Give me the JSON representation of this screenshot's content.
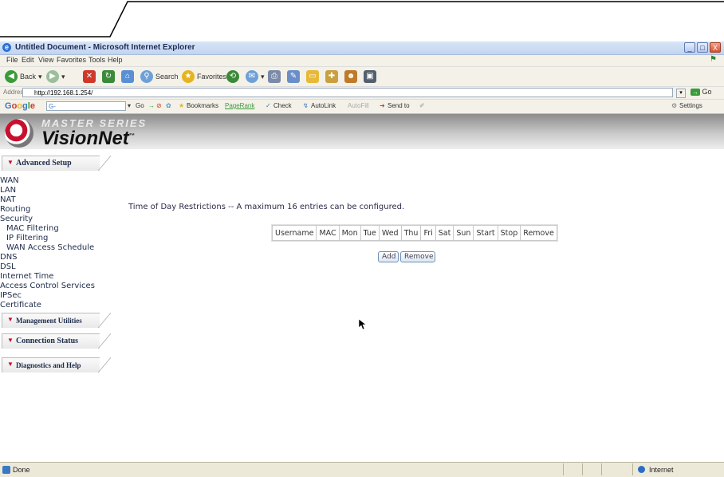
{
  "window": {
    "title": "Untitled Document - Microsoft Internet Explorer",
    "minimize": "_",
    "maximize": "□",
    "close": "X"
  },
  "menu": [
    "File",
    "Edit",
    "View",
    "Favorites",
    "Tools",
    "Help"
  ],
  "toolbar": {
    "back": "Back",
    "search": "Search",
    "favorites": "Favorites"
  },
  "address": {
    "label": "Address",
    "url": "http://192.168.1.254/",
    "go": "Go"
  },
  "googlebar": {
    "logo": "Google",
    "search_value": "G-",
    "go": "Go",
    "bookmarks": "Bookmarks",
    "pagerank": "PageRank",
    "check": "Check",
    "autolink": "AutoLink",
    "autofill": "AutoFill",
    "send_to": "Send to",
    "settings": "Settings"
  },
  "banner": {
    "series": "MASTER SERIES",
    "brand": "VisionNet",
    "tm": "™"
  },
  "sidebar": {
    "advanced_setup": "Advanced Setup",
    "links": [
      "WAN",
      "LAN",
      "NAT",
      "Routing",
      "Security"
    ],
    "security_sub": [
      "MAC Filtering",
      "IP Filtering",
      "WAN Access Schedule"
    ],
    "links2": [
      "DNS",
      "DSL",
      "Internet Time",
      "Access Control Services",
      "IPSec",
      "Certificate"
    ],
    "management_utilities": "Management Utilities",
    "connection_status": "Connection Status",
    "diagnostics_help": "Diagnostics and Help"
  },
  "main": {
    "heading": "Time of Day Restrictions -- A maximum 16 entries can be configured.",
    "columns": [
      "Username",
      "MAC",
      "Mon",
      "Tue",
      "Wed",
      "Thu",
      "Fri",
      "Sat",
      "Sun",
      "Start",
      "Stop",
      "Remove"
    ],
    "add_button": "Add",
    "remove_button": "Remove"
  },
  "status": {
    "text": "Done",
    "zone": "Internet"
  }
}
